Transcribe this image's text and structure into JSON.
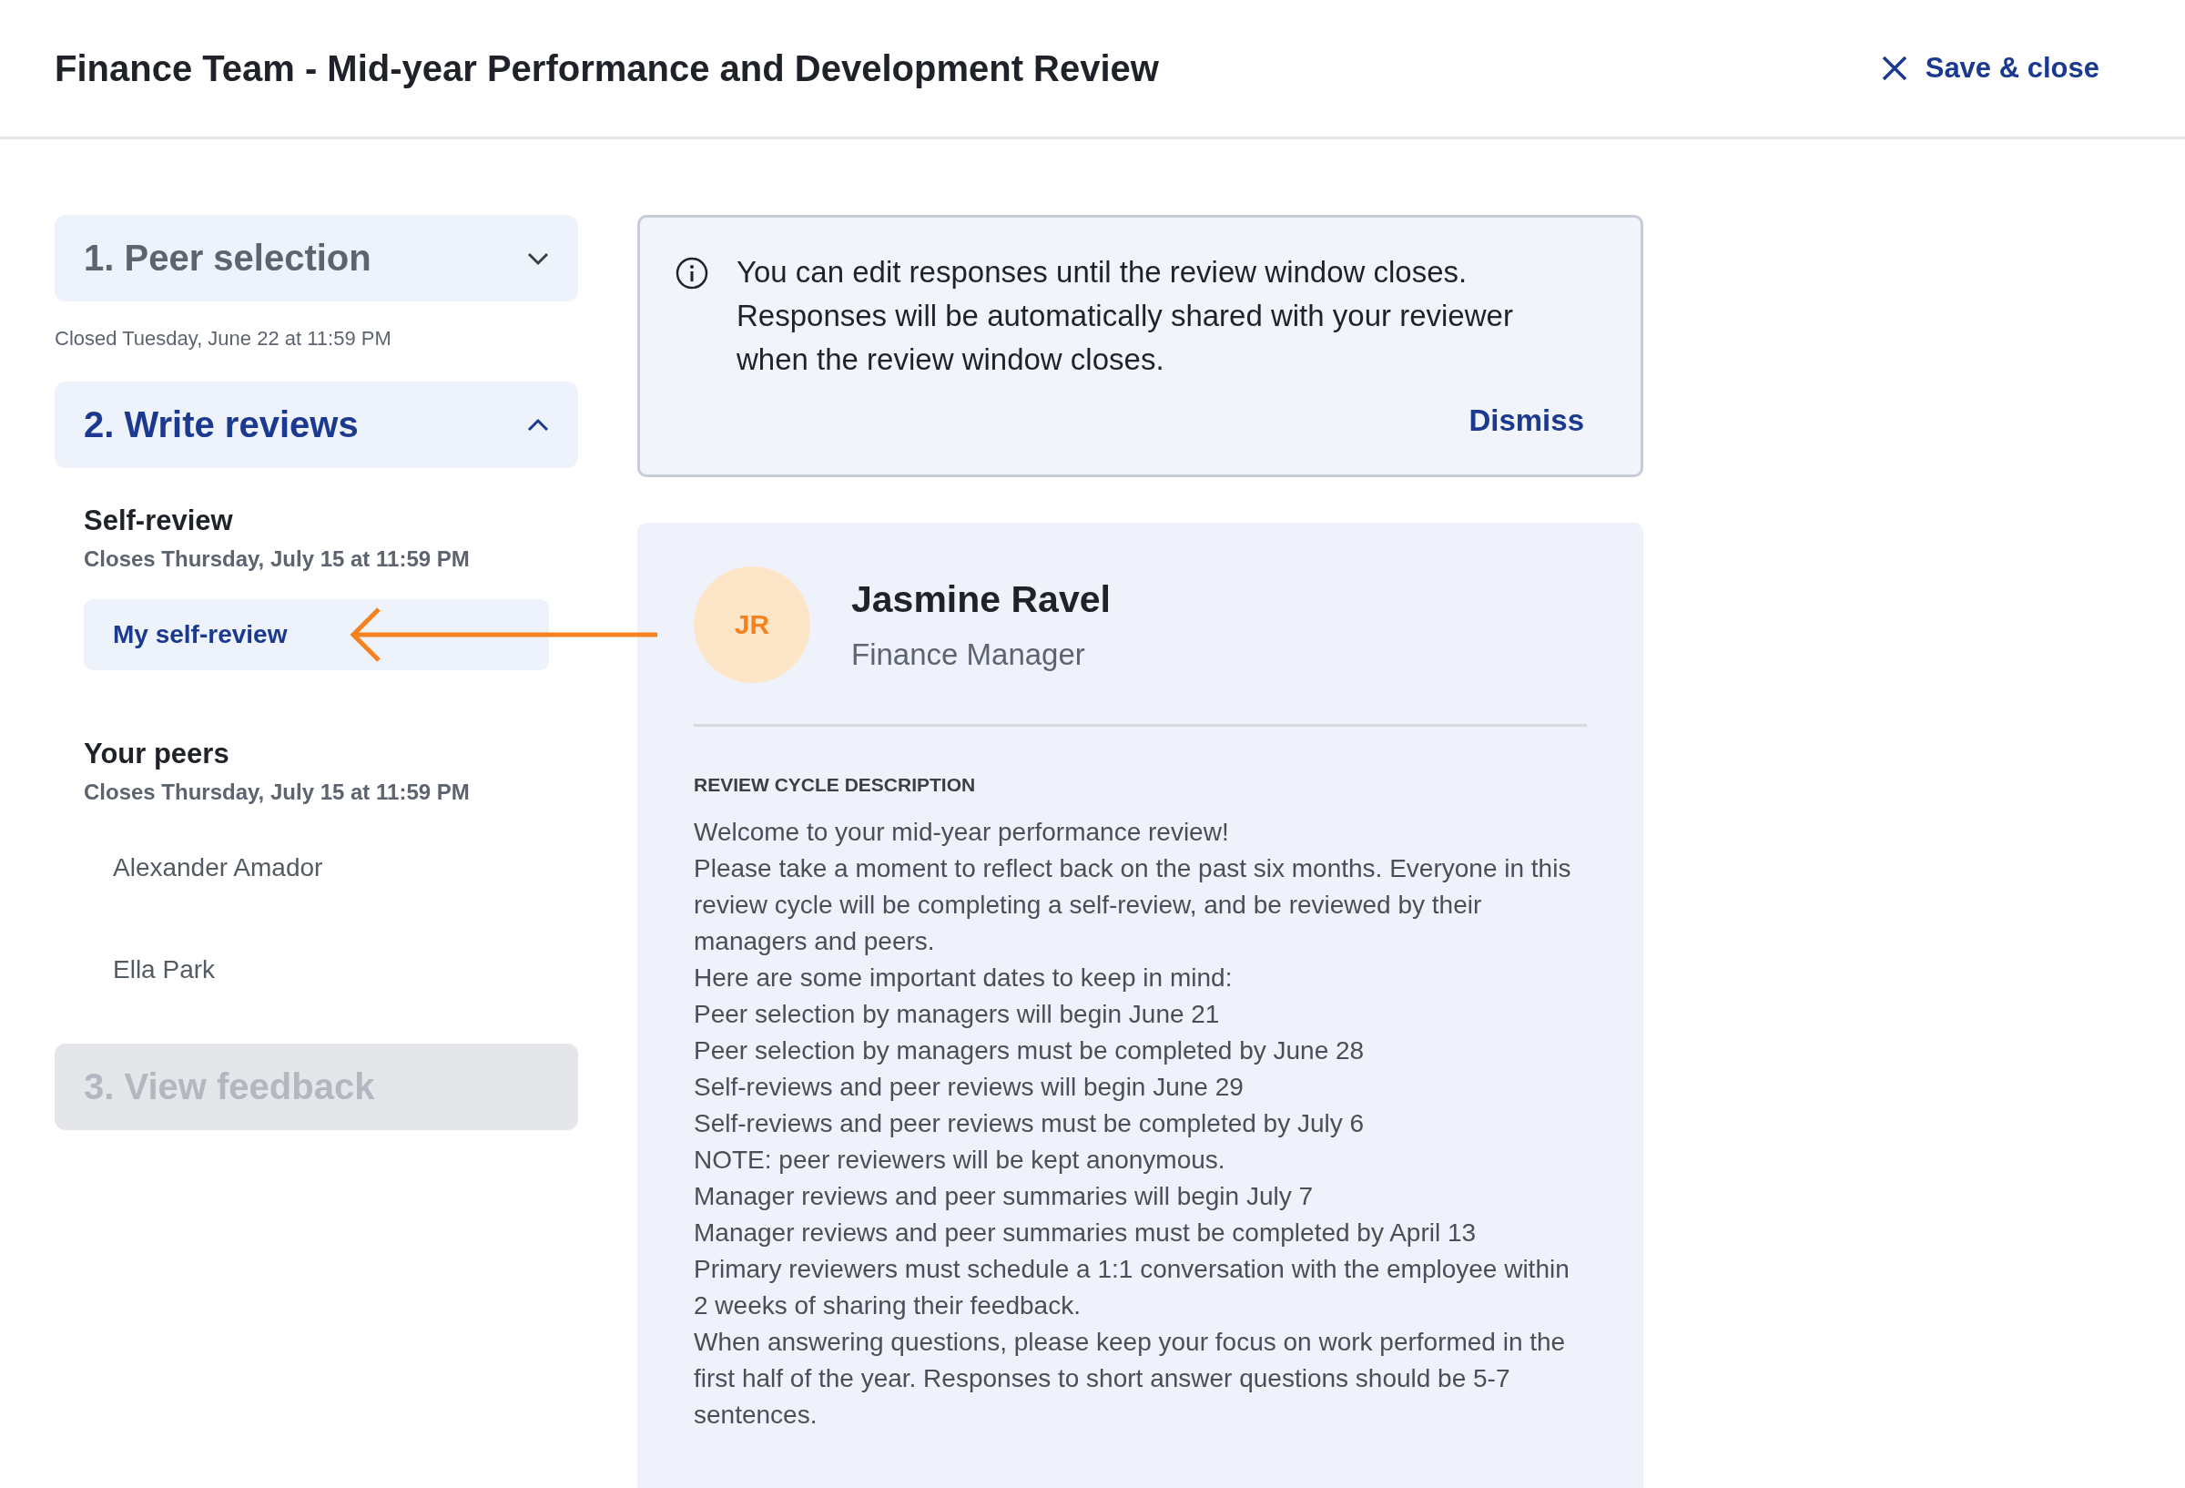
{
  "header": {
    "title": "Finance Team - Mid-year Performance and Development Review",
    "close_label": "Save & close"
  },
  "steps": [
    {
      "label": "1. Peer selection",
      "expanded": false,
      "disabled": false,
      "note": "Closed Tuesday, June 22 at 11:59 PM"
    },
    {
      "label": "2. Write reviews",
      "expanded": true,
      "disabled": false,
      "groups": [
        {
          "title": "Self-review",
          "due": "Closes Thursday, July 15 at 11:59 PM",
          "items": [
            {
              "label": "My self-review",
              "selected": true
            }
          ]
        },
        {
          "title": "Your peers",
          "due": "Closes Thursday, July 15 at 11:59 PM",
          "items": [
            {
              "label": "Alexander Amador",
              "selected": false
            },
            {
              "label": "Ella Park",
              "selected": false
            }
          ]
        }
      ]
    },
    {
      "label": "3. View feedback",
      "expanded": false,
      "disabled": true
    }
  ],
  "notice": {
    "lines": [
      "You can edit responses until the review window closes.",
      "Responses will be automatically shared with your reviewer",
      "when the review window closes."
    ],
    "action": "Dismiss"
  },
  "profile": {
    "initials": "JR",
    "name": "Jasmine Ravel",
    "role": "Finance Manager",
    "section_title": "REVIEW CYCLE DESCRIPTION",
    "paragraphs": [
      "Welcome to your mid-year performance review!",
      "Please take a moment to reflect back on the past six months. Everyone in this review cycle will be completing a self-review, and be reviewed by their managers and peers.",
      "Here are some important dates to keep in mind:",
      "Peer selection by managers will begin June 21",
      "Peer selection by managers must be completed by June 28",
      "Self-reviews and peer reviews will begin June 29",
      "Self-reviews and peer reviews must be completed by July 6",
      "NOTE: peer reviewers will be kept anonymous.",
      "Manager reviews and peer summaries will begin July 7",
      "Manager reviews and peer summaries must be completed by April 13",
      "Primary reviewers must schedule a 1:1 conversation with the employee within 2 weeks of sharing their feedback.",
      "When answering questions, please keep your focus on work performed in the first half of the year. Responses to short answer questions should be 5-7 sentences."
    ]
  }
}
